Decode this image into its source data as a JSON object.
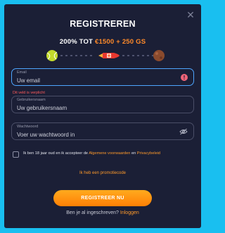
{
  "modal": {
    "title": "REGISTREREN",
    "close_icon": "close-icon"
  },
  "bonus": {
    "prefix": "200% TOT",
    "amount": "€1500 + 250 GS"
  },
  "colors": {
    "accent": "#ff8a2a",
    "background": "#1b1f36",
    "focus_border": "#4ea6ff",
    "error": "#ff5b5b",
    "page_background": "#19bff0"
  },
  "form": {
    "email": {
      "label": "Email",
      "placeholder": "Uw email",
      "error": "Dit veld is verplicht",
      "alert_icon": "alert-icon"
    },
    "username": {
      "label": "Gebruikersnaam",
      "placeholder": "Uw gebruikersnaam"
    },
    "password": {
      "label": "Wachtwoord",
      "placeholder": "Voer uw wachtwoord in",
      "toggle_icon": "eye-off-icon"
    },
    "terms": {
      "before": "Ik ben 18 jaar oud en ik accepteer de",
      "link1": "Algemene voorwaarden",
      "between": "en",
      "link2": "Privacybeleid"
    },
    "promo_link": "Ik heb een promotiecode",
    "register_button": "REGISTREER NU",
    "login_prompt": "Ben je al ingeschreven?",
    "login_link": "Inloggen"
  }
}
